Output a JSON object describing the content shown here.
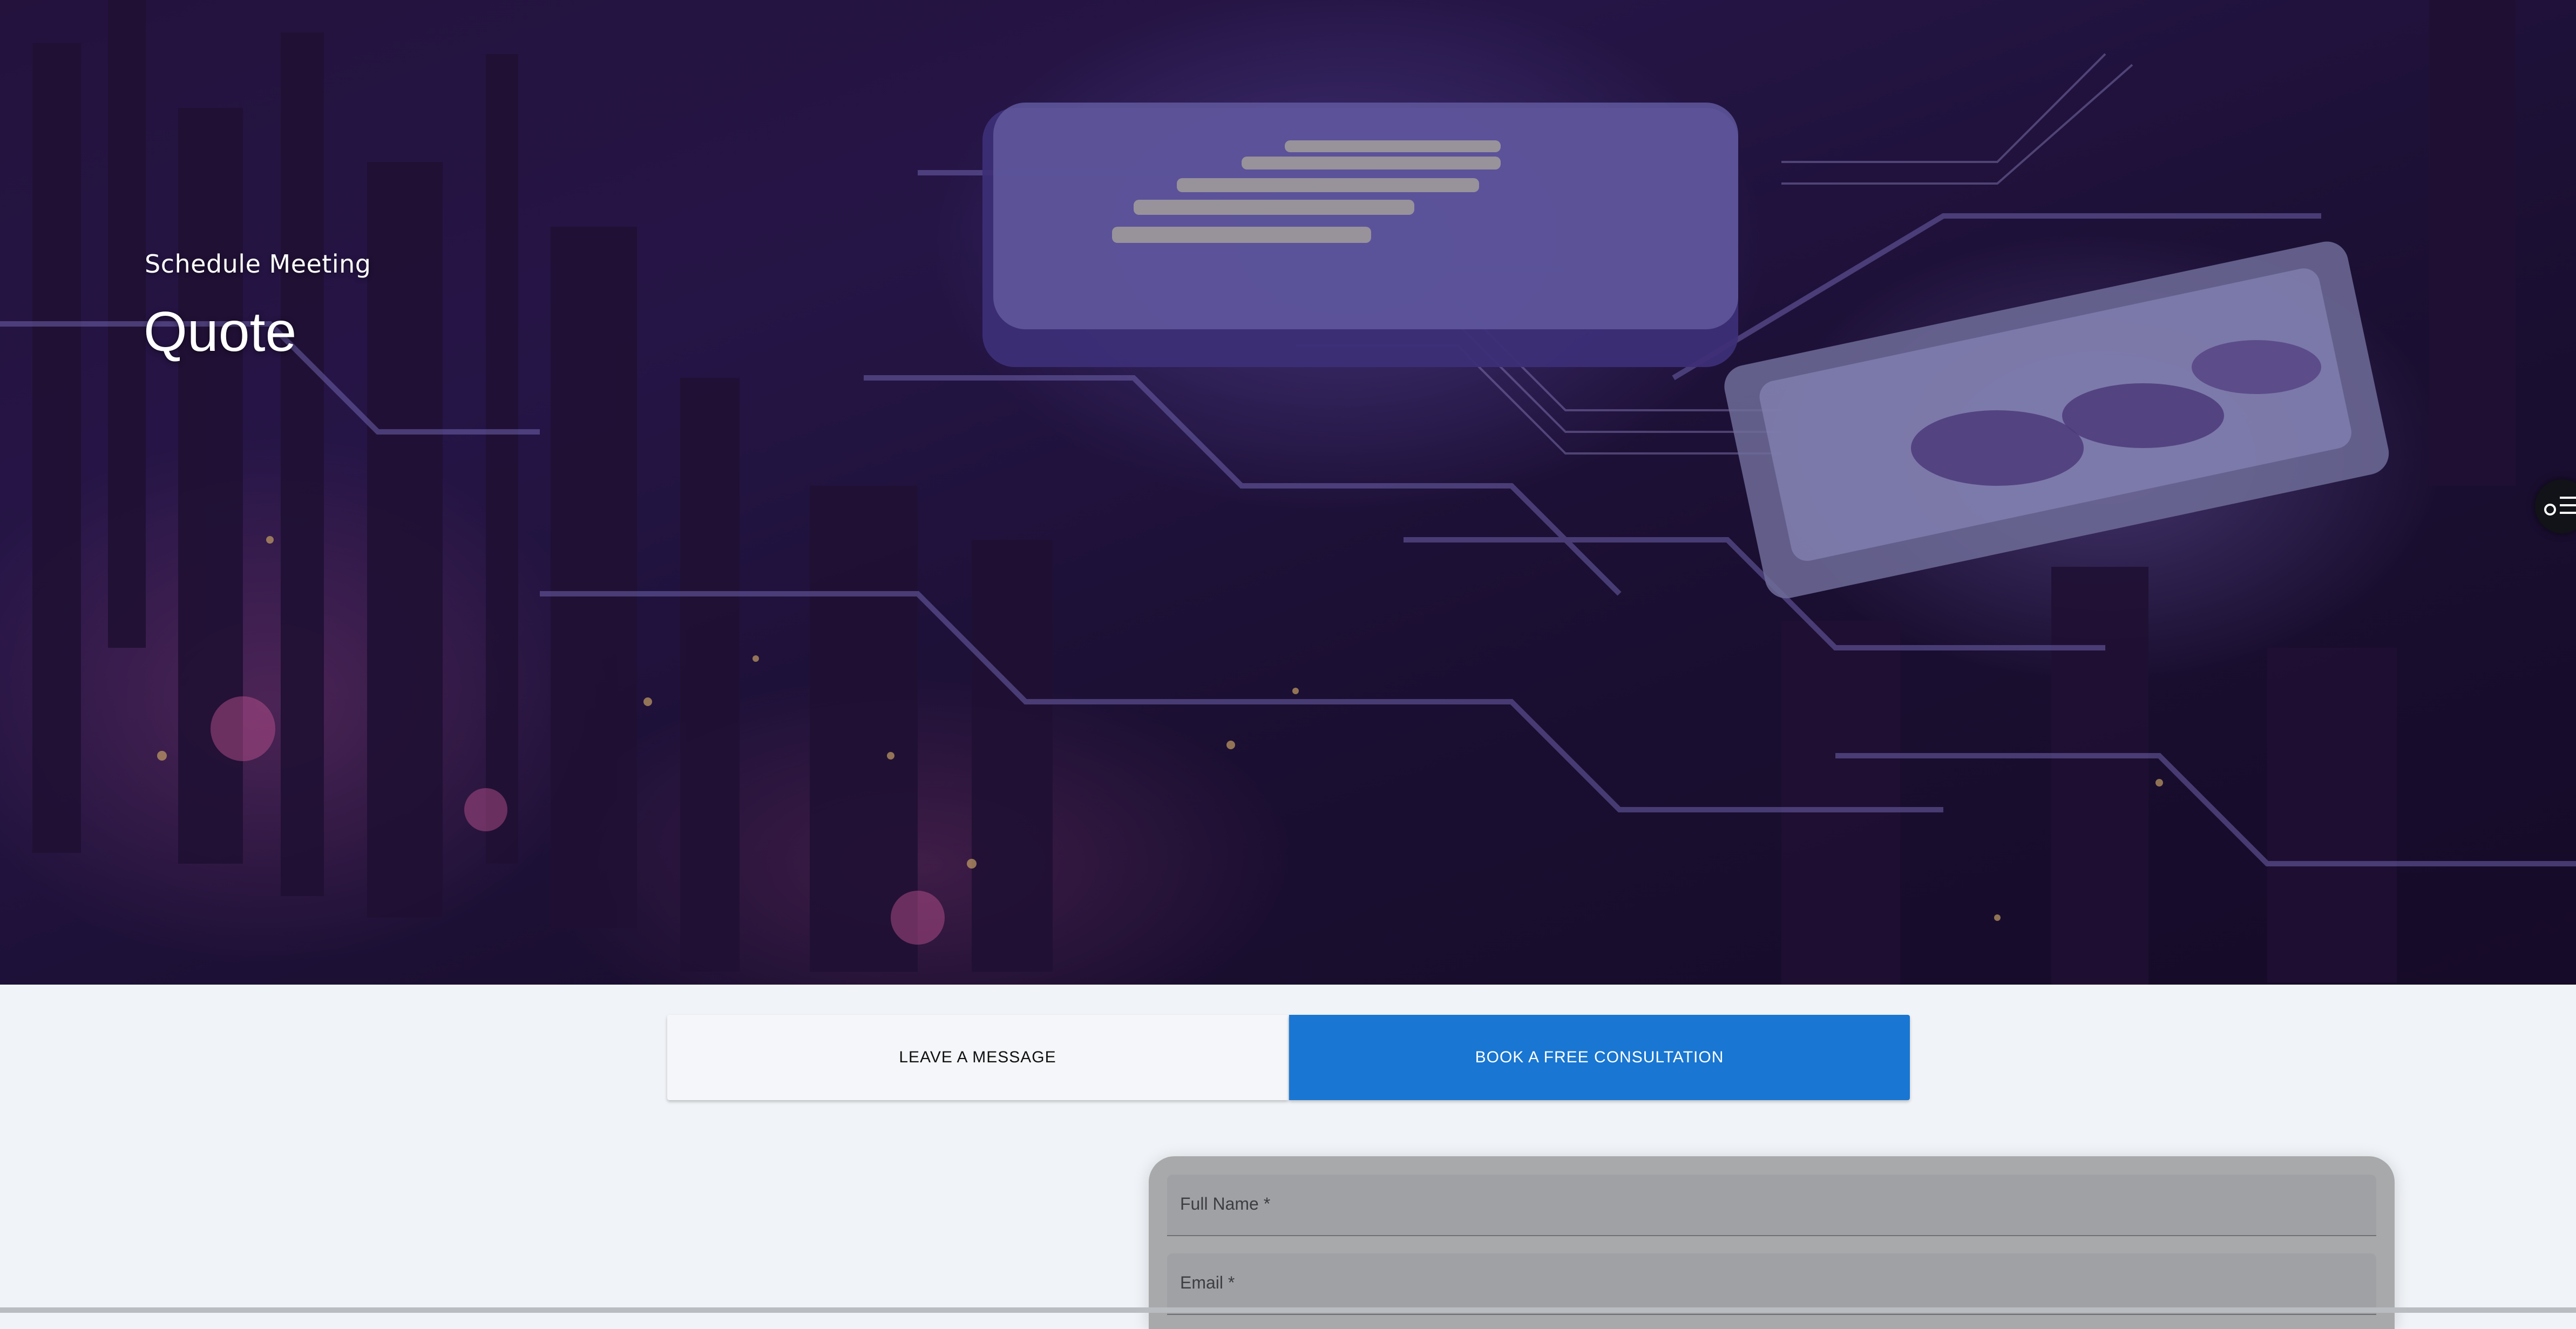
{
  "hero": {
    "subtitle": "Schedule Meeting",
    "title": "Quote",
    "widget_icon": "settings-list-icon"
  },
  "tabs": [
    {
      "label": "LEAVE A MESSAGE",
      "active": false
    },
    {
      "label": "BOOK A FREE CONSULTATION",
      "active": true
    }
  ],
  "form": {
    "full_name_label": "Full Name *",
    "email_label": "Email *",
    "full_name_value": "",
    "email_value": ""
  },
  "colors": {
    "accent": "#1976d2",
    "page_background": "#f0f3f7",
    "card_background": "#a8a9ab"
  }
}
